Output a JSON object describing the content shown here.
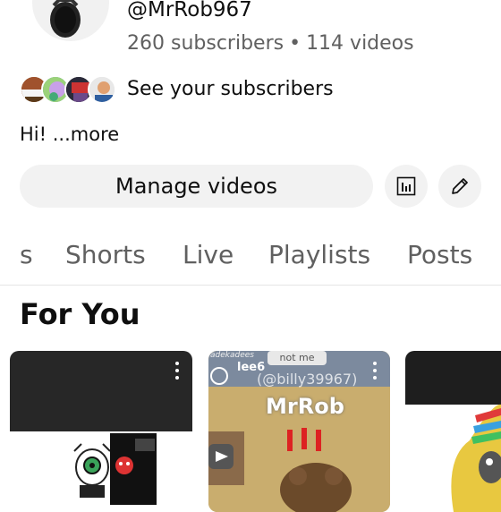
{
  "channel": {
    "handle": "@MrRob967",
    "subscribers": "260 subscribers",
    "separator": "•",
    "videos": "114 videos",
    "see_subscribers_label": "See your subscribers",
    "bio": "Hi!",
    "more_label": "...more"
  },
  "actions": {
    "manage_videos_label": "Manage videos",
    "analytics_icon": "analytics-icon",
    "edit_icon": "pencil-icon"
  },
  "tabs": [
    {
      "label": "s"
    },
    {
      "label": "Shorts"
    },
    {
      "label": "Live"
    },
    {
      "label": "Playlists"
    },
    {
      "label": "Posts"
    }
  ],
  "for_you": {
    "title": "For You",
    "cards": [
      {
        "overlay_text": ""
      },
      {
        "overlay_top": "not me",
        "overlay_name": "lee6",
        "overlay_handle": "(@billy39967)",
        "overlay_title": "MrRob",
        "overlay_corner": "adekadees"
      },
      {
        "overlay_text": ""
      }
    ]
  },
  "colors": {
    "text_primary": "#0f0f0f",
    "text_secondary": "#606060",
    "button_bg": "#f2f2f2"
  }
}
